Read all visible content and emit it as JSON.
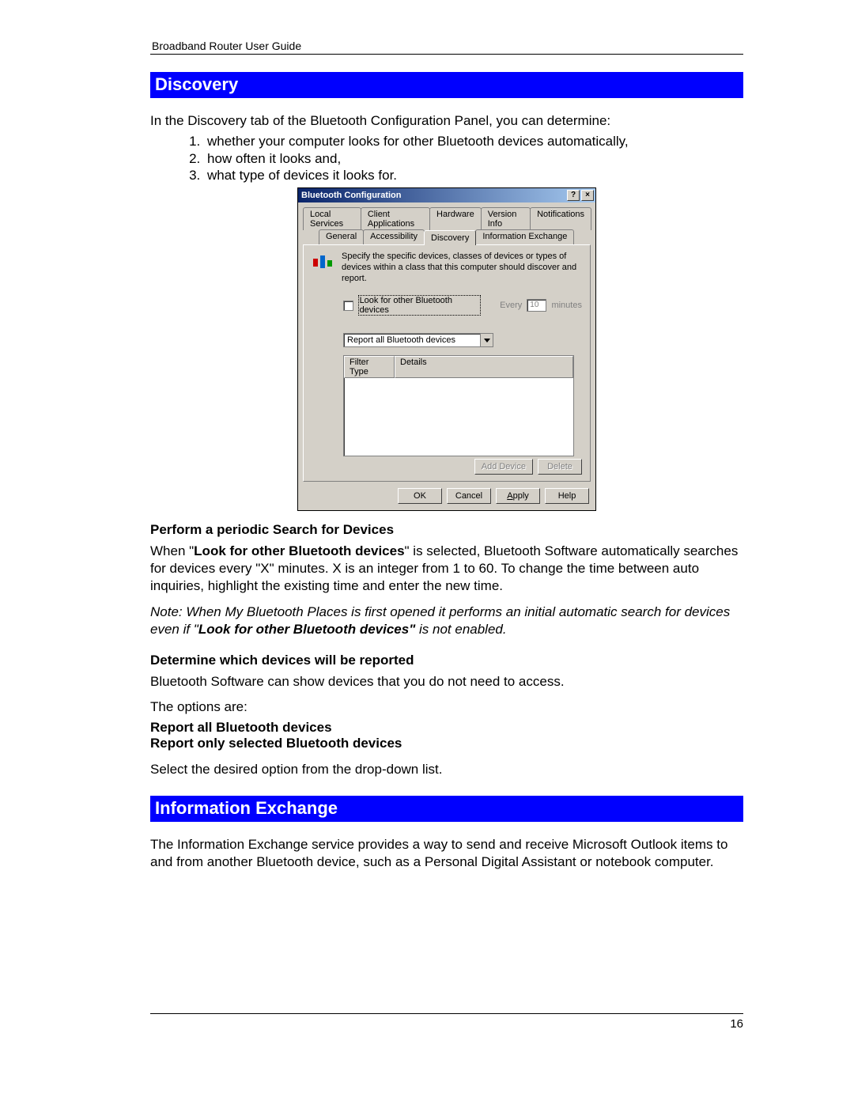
{
  "header": "Broadband Router User Guide",
  "page_number": "16",
  "section_discovery": {
    "title": "Discovery",
    "intro": "In the Discovery tab of the Bluetooth Configuration Panel, you can determine:",
    "list": [
      "whether your computer looks for other Bluetooth devices automatically,",
      "how often it looks and,",
      "what type of devices it looks for."
    ]
  },
  "dialog": {
    "title": "Bluetooth Configuration",
    "help_btn": "?",
    "close_btn": "×",
    "tabs_row1": [
      "Local Services",
      "Client Applications",
      "Hardware",
      "Version Info",
      "Notifications"
    ],
    "tabs_row2": [
      "General",
      "Accessibility",
      "Discovery",
      "Information Exchange"
    ],
    "active_tab": "Discovery",
    "description": "Specify the specific devices, classes of devices or types of devices within a class that this computer should discover and report.",
    "look_label": "Look for other Bluetooth devices",
    "every_label": "Every",
    "every_value": "10",
    "minutes_label": "minutes",
    "dropdown_selected": "Report all Bluetooth devices",
    "list_columns": [
      "Filter Type",
      "Details"
    ],
    "add_device_btn": "Add Device",
    "delete_btn": "Delete",
    "ok_btn": "OK",
    "cancel_btn": "Cancel",
    "apply_btn_pre": "A",
    "apply_btn_rest": "pply",
    "help_btn2": "Help"
  },
  "periodic": {
    "heading": "Perform a periodic Search for Devices",
    "p1_pre": "When \"",
    "p1_bold": "Look for other Bluetooth devices",
    "p1_post": "\" is selected, Bluetooth Software automatically searches for devices every \"X\" minutes. X is an integer from 1 to 60. To change the time between auto inquiries, highlight the existing time and enter the new time.",
    "note_pre": "Note: When My Bluetooth Places is first opened it performs an initial automatic search for devices even if \"",
    "note_bold": "Look for other Bluetooth devices\"",
    "note_post": " is not enabled."
  },
  "determine": {
    "heading": "Determine which devices will be reported",
    "p1": "Bluetooth Software can show devices that you do not need to access.",
    "p2": "The options are:",
    "opt1": "Report all Bluetooth devices",
    "opt2": "Report only selected Bluetooth devices",
    "p3": "Select the desired option from the drop-down list."
  },
  "section_info_exchange": {
    "title": "Information Exchange",
    "p1": "The Information Exchange service provides a way to send and receive Microsoft Outlook items to and from another Bluetooth device, such as a Personal Digital Assistant or notebook computer."
  }
}
